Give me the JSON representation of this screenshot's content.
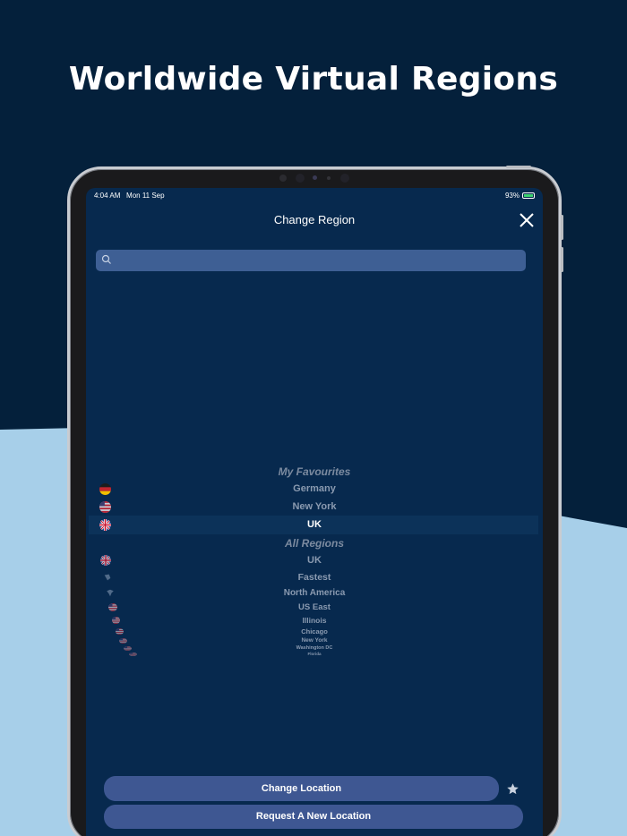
{
  "page": {
    "headline": "Worldwide Virtual Regions",
    "colors": {
      "background_dark": "#04203b",
      "background_light": "#a7cfe9",
      "screen": "#07294e",
      "button": "#3e5792"
    }
  },
  "status_bar": {
    "time": "4:04 AM",
    "date": "Mon 11 Sep",
    "battery": "93%"
  },
  "modal": {
    "title": "Change Region",
    "search": {
      "value": "",
      "placeholder": ""
    }
  },
  "favourites": {
    "heading": "My Favourites",
    "items": [
      {
        "label": "Germany",
        "flag": "germany-flag-icon"
      },
      {
        "label": "New York",
        "flag": "usa-flag-icon"
      },
      {
        "label": "UK",
        "flag": "uk-flag-icon",
        "selected": true
      }
    ]
  },
  "all_regions": {
    "heading": "All Regions",
    "items": [
      {
        "label": "UK",
        "flag": "uk-flag-icon"
      },
      {
        "label": "Fastest",
        "flag": "bolt-globe-icon"
      },
      {
        "label": "North America",
        "flag": "north-america-icon"
      },
      {
        "label": "US East",
        "flag": "usa-flag-icon"
      },
      {
        "label": "Illinois",
        "flag": "usa-flag-icon"
      },
      {
        "label": "Chicago",
        "flag": "usa-flag-icon"
      },
      {
        "label": "New York",
        "flag": "usa-flag-icon"
      },
      {
        "label": "Washington DC",
        "flag": "usa-flag-icon"
      },
      {
        "label": "Florida",
        "flag": "usa-flag-icon"
      }
    ]
  },
  "actions": {
    "change_location": "Change Location",
    "request_location": "Request A New Location",
    "favourite_icon": "star-icon"
  }
}
